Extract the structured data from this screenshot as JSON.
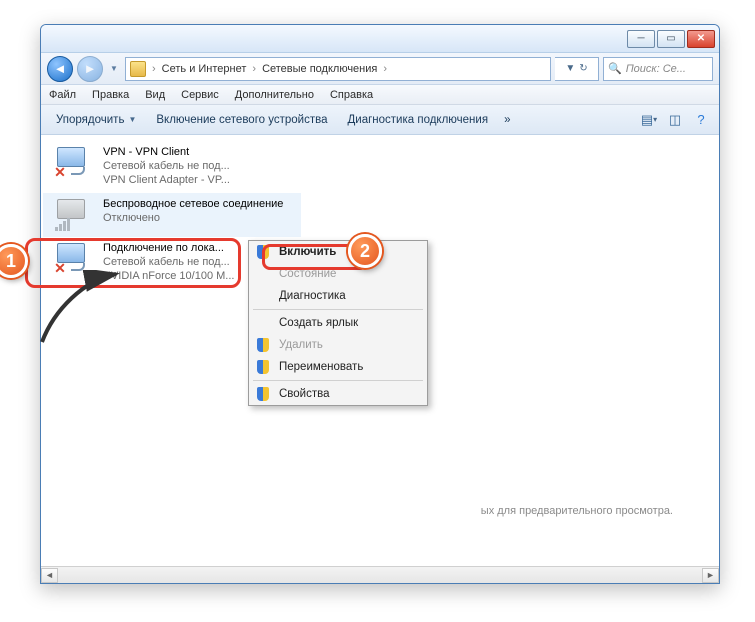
{
  "window": {
    "minimize": "─",
    "maximize": "▭",
    "close": "✕"
  },
  "nav": {
    "back": "◄",
    "forward": "►",
    "refresh": "↻",
    "dropdown": "▼"
  },
  "breadcrumb": {
    "level1": "Сеть и Интернет",
    "level2": "Сетевые подключения",
    "sep": "›"
  },
  "search": {
    "placeholder": "Поиск: Се..."
  },
  "menu": {
    "file": "Файл",
    "edit": "Правка",
    "view": "Вид",
    "service": "Сервис",
    "extra": "Дополнительно",
    "help": "Справка"
  },
  "cmd": {
    "organize": "Упорядочить",
    "enable_device": "Включение сетевого устройства",
    "diagnose": "Диагностика подключения"
  },
  "connections": [
    {
      "title": "VPN - VPN Client",
      "line2": "Сетевой кабель не под...",
      "line3": "VPN Client Adapter - VP...",
      "status": "disconnected"
    },
    {
      "title": "Беспроводное сетевое соединение",
      "line2": "Отключено",
      "line3": "",
      "status": "disabled",
      "selected": true
    },
    {
      "title": "Подключение по лока...",
      "line2": "Сетевой кабель не под...",
      "line3": "NVIDIA nForce 10/100 M...",
      "status": "disconnected"
    }
  ],
  "context_menu": {
    "enable": "Включить",
    "status": "Состояние",
    "diagnostics": "Диагностика",
    "create_shortcut": "Создать ярлык",
    "delete": "Удалить",
    "rename": "Переименовать",
    "properties": "Свойства"
  },
  "preview_hint": "ых для предварительного просмотра.",
  "annotations": {
    "b1": "1",
    "b2": "2"
  }
}
